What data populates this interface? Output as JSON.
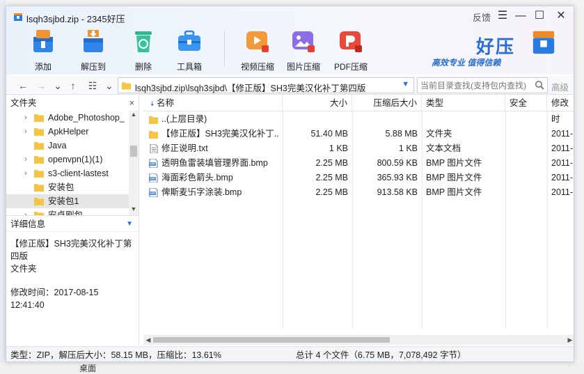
{
  "window": {
    "title": "lsqh3sjbd.zip - 2345好压",
    "feedback": "反馈",
    "menu_glyph": "☰",
    "minimize_glyph": "—",
    "maximize_glyph": "☐",
    "close_glyph": "✕"
  },
  "toolbar": {
    "add": "添加",
    "extract_to": "解压到",
    "delete": "删除",
    "toolbox": "工具箱",
    "video_compress": "视频压缩",
    "image_compress": "图片压缩",
    "pdf_compress": "PDF压缩"
  },
  "brand": {
    "name": "好压",
    "slogan": "高效专业  值得信赖"
  },
  "address": {
    "path": "lsqh3sjbd.zip\\lsqh3sjbd\\【修正版】SH3完美汉化补丁第四版",
    "search_placeholder": "当前目录查找(支持包内查找)",
    "advanced": "高级"
  },
  "sidebar": {
    "header": "文件夹",
    "close_glyph": "×",
    "items": [
      {
        "label": "Adobe_Photoshop_",
        "expandable": true
      },
      {
        "label": "ApkHelper",
        "expandable": true
      },
      {
        "label": "Java",
        "expandable": false
      },
      {
        "label": "openvpn(1)(1)",
        "expandable": true
      },
      {
        "label": "s3-client-lastest",
        "expandable": true
      },
      {
        "label": "安装包",
        "expandable": false
      },
      {
        "label": "安装包1",
        "expandable": false
      },
      {
        "label": "安卓刷包",
        "expandable": true
      }
    ],
    "selected_index": 6
  },
  "details": {
    "header": "详细信息",
    "name": "【修正版】SH3完美汉化补丁第四版",
    "type": "文件夹",
    "modified_label": "修改时间：",
    "modified_value": "2017-08-15 12:41:40"
  },
  "columns": {
    "name": "名称",
    "size": "大小",
    "packed": "压缩后大小",
    "type": "类型",
    "security": "安全",
    "modified": "修改时"
  },
  "files": [
    {
      "name": "..(上层目录)",
      "size": "",
      "packed": "",
      "type": "",
      "modified": "",
      "icon": "folder-icon"
    },
    {
      "name": "【修正版】SH3完美汉化补丁...",
      "size": "51.40 MB",
      "packed": "5.88 MB",
      "type": "文件夹",
      "modified": "2011-",
      "icon": "folder-icon"
    },
    {
      "name": "修正说明.txt",
      "size": "1 KB",
      "packed": "1 KB",
      "type": "文本文档",
      "modified": "2011-",
      "icon": "text-file-icon"
    },
    {
      "name": "透明鱼雷装填管理界面.bmp",
      "size": "2.25 MB",
      "packed": "800.59 KB",
      "type": "BMP 图片文件",
      "modified": "2011-",
      "icon": "bmp-file-icon"
    },
    {
      "name": "海面彩色箭头.bmp",
      "size": "2.25 MB",
      "packed": "365.93 KB",
      "type": "BMP 图片文件",
      "modified": "2011-",
      "icon": "bmp-file-icon"
    },
    {
      "name": "俾斯麦卐字涂装.bmp",
      "size": "2.25 MB",
      "packed": "913.58 KB",
      "type": "BMP 图片文件",
      "modified": "2011-",
      "icon": "bmp-file-icon"
    }
  ],
  "status": {
    "left": "类型：ZIP，解压后大小：58.15 MB，压缩比：13.61%",
    "right": "总计 4 个文件（6.75 MB，7,078,492 字节）"
  },
  "desktop": {
    "bottom_text": "桌面"
  },
  "colors": {
    "accent": "#2a6fd0",
    "folder": "#f5c542",
    "selection": "#e6e6e6"
  }
}
